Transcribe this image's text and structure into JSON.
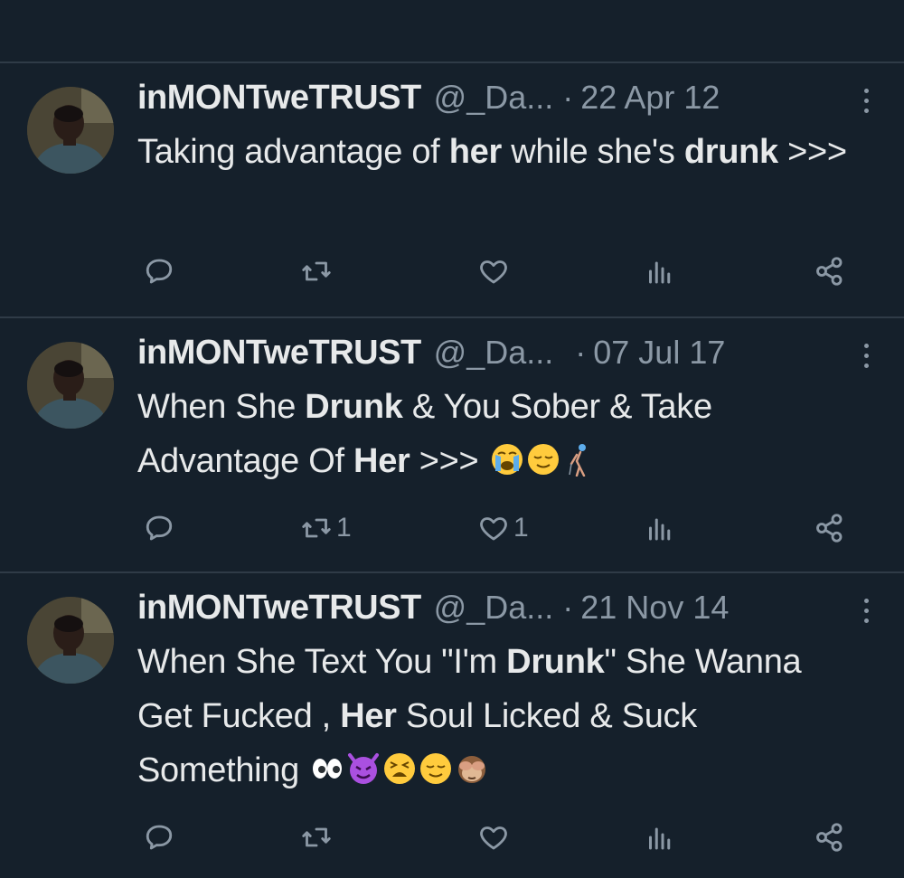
{
  "colors": {
    "background": "#15202b",
    "text": "#e7e9ea",
    "secondary": "#8b98a5",
    "divider": "#2f3b47"
  },
  "tweets": [
    {
      "display_name": "inMONTweTRUST",
      "handle": "@_Da...",
      "dot": "·",
      "date": "22 Apr 12",
      "text_parts": [
        "Taking advantage of ",
        "her",
        " while she's ",
        "drunk",
        " >>>"
      ],
      "emojis": [],
      "actions": {
        "reply_icon": "reply-icon",
        "retweet_icon": "retweet-icon",
        "retweet_count": "",
        "like_icon": "like-icon",
        "like_count": "",
        "views_icon": "views-icon",
        "share_icon": "share-icon"
      }
    },
    {
      "display_name": "inMONTweTRUST",
      "handle": "@_Da...",
      "dot": "·",
      "date": "07 Jul 17",
      "text_parts": [
        "When She ",
        "Drunk",
        " & You Sober & Take Advantage Of ",
        "Her",
        " >>> "
      ],
      "emojis": [
        "loudly-crying-face-emoji",
        "relieved-face-emoji",
        "golfer-emoji"
      ],
      "actions": {
        "reply_icon": "reply-icon",
        "retweet_icon": "retweet-icon",
        "retweet_count": "1",
        "like_icon": "like-icon",
        "like_count": "1",
        "views_icon": "views-icon",
        "share_icon": "share-icon"
      }
    },
    {
      "display_name": "inMONTweTRUST",
      "handle": "@_Da...",
      "dot": "·",
      "date": "21 Nov 14",
      "text_parts": [
        "When She Text You \"I'm ",
        "Drunk",
        "\" She Wanna Get Fucked , ",
        "Her",
        " Soul Licked & Suck Something "
      ],
      "emojis": [
        "eyes-emoji",
        "smiling-devil-emoji",
        "tired-face-emoji",
        "relieved-face-emoji",
        "see-no-evil-monkey-emoji"
      ],
      "actions": {
        "reply_icon": "reply-icon",
        "retweet_icon": "retweet-icon",
        "retweet_count": "",
        "like_icon": "like-icon",
        "like_count": "",
        "views_icon": "views-icon",
        "share_icon": "share-icon"
      }
    }
  ]
}
